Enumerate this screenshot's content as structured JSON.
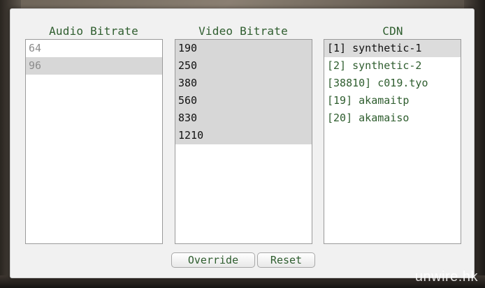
{
  "audio": {
    "title": "Audio Bitrate",
    "items": [
      "64",
      "96"
    ],
    "selected_index": 1
  },
  "video": {
    "title": "Video Bitrate",
    "items": [
      "190",
      "250",
      "380",
      "560",
      "830",
      "1210"
    ]
  },
  "cdn": {
    "title": "CDN",
    "items": [
      "[1] synthetic-1",
      "[2] synthetic-2",
      "[38810] c019.tyo",
      "[19] akamaitp",
      "[20] akamaiso"
    ],
    "selected_index": 0
  },
  "buttons": {
    "override": "Override",
    "reset": "Reset"
  },
  "watermark": "unwire.hk"
}
